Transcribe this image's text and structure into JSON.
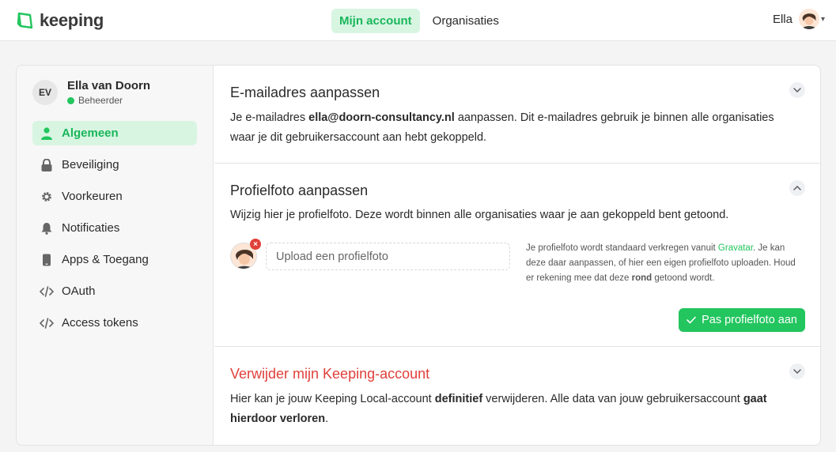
{
  "brand": {
    "name": "keeping",
    "color": "#22c55e"
  },
  "nav": {
    "tabs": [
      {
        "label": "Mijn account",
        "active": true
      },
      {
        "label": "Organisaties",
        "active": false
      }
    ]
  },
  "user": {
    "name": "Ella"
  },
  "profile": {
    "initials": "EV",
    "name": "Ella van Doorn",
    "role": "Beheerder"
  },
  "sidebar": {
    "items": [
      {
        "label": "Algemeen",
        "icon": "user-icon",
        "active": true
      },
      {
        "label": "Beveiliging",
        "icon": "lock-icon"
      },
      {
        "label": "Voorkeuren",
        "icon": "gear-icon"
      },
      {
        "label": "Notificaties",
        "icon": "bell-icon"
      },
      {
        "label": "Apps & Toegang",
        "icon": "phone-icon"
      },
      {
        "label": "OAuth",
        "icon": "code-icon"
      },
      {
        "label": "Access tokens",
        "icon": "code-icon"
      }
    ]
  },
  "email_section": {
    "title": "E-mailadres aanpassen",
    "text_pre": "Je e-mailadres ",
    "email": "ella@doorn-consultancy.nl",
    "text_post": " aanpassen. Dit e-mailadres gebruik je binnen alle organisaties waar je dit gebruikersaccount aan hebt gekoppeld."
  },
  "photo_section": {
    "title": "Profielfoto aanpassen",
    "text": "Wijzig hier je profielfoto. Deze wordt binnen alle organisaties waar je aan gekoppeld bent getoond.",
    "upload_label": "Upload een profielfoto",
    "hint_pre": "Je profielfoto wordt standaard verkregen vanuit ",
    "hint_link": "Gravatar",
    "hint_mid": ". Je kan deze daar aanpassen, of hier een eigen profielfoto uploaden. Houd er rekening mee dat deze ",
    "hint_bold": "rond",
    "hint_post": " getoond wordt.",
    "save_label": "Pas profielfoto aan"
  },
  "delete_section": {
    "title": "Verwijder mijn Keeping-account",
    "text_pre": "Hier kan je jouw Keeping Local-account ",
    "text_bold1": "definitief",
    "text_mid": " verwijderen. Alle data van jouw gebruikersaccount ",
    "text_bold2": "gaat hierdoor verloren",
    "text_post": "."
  },
  "colors": {
    "accent": "#22c55e",
    "accent_bg": "#d8f5e2",
    "danger": "#e0403a"
  }
}
